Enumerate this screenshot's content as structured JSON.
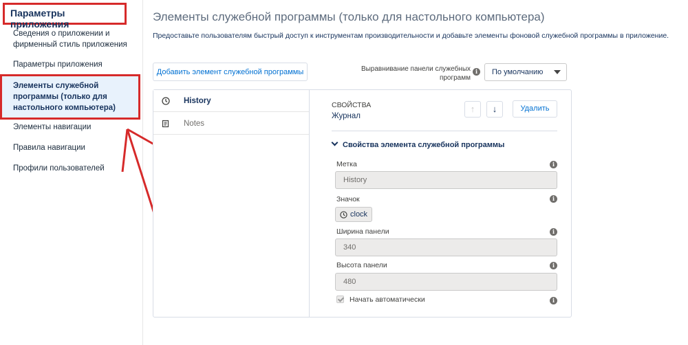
{
  "sidebar": {
    "title": "Параметры приложения",
    "items": [
      {
        "label": "Сведения о приложении и фирменный стиль приложения"
      },
      {
        "label": "Параметры приложения"
      },
      {
        "label": "Элементы служебной программы (только для настольного компьютера)"
      },
      {
        "label": "Элементы навигации"
      },
      {
        "label": "Правила навигации"
      },
      {
        "label": "Профили пользователей"
      }
    ]
  },
  "main": {
    "title": "Элементы служебной программы (только для настольного компьютера)",
    "description": "Предоставьте пользователям быстрый доступ к инструментам производительности и добавьте элементы фоновой служебной программы в приложение.",
    "add_button": "Добавить элемент служебной программы",
    "alignment_label": "Выравнивание панели служебных программ",
    "alignment_value": "По умолчанию"
  },
  "utility_items": [
    {
      "label": "History",
      "icon": "clock-icon"
    },
    {
      "label": "Notes",
      "icon": "notes-icon"
    }
  ],
  "properties": {
    "heading": "СВОЙСТВА",
    "item_name": "Журнал",
    "delete_button": "Удалить",
    "section_title": "Свойства элемента служебной программы",
    "label_field": {
      "label": "Метка",
      "value": "History"
    },
    "icon_field": {
      "label": "Значок",
      "value": "clock"
    },
    "width_field": {
      "label": "Ширина панели",
      "value": "340"
    },
    "height_field": {
      "label": "Высота панели",
      "value": "480"
    },
    "autostart": {
      "label": "Начать автоматически",
      "checked": true
    }
  },
  "colors": {
    "annotation_red": "#d62a2a",
    "link_blue": "#0070d2",
    "selected_bg": "#e8f2fc"
  }
}
